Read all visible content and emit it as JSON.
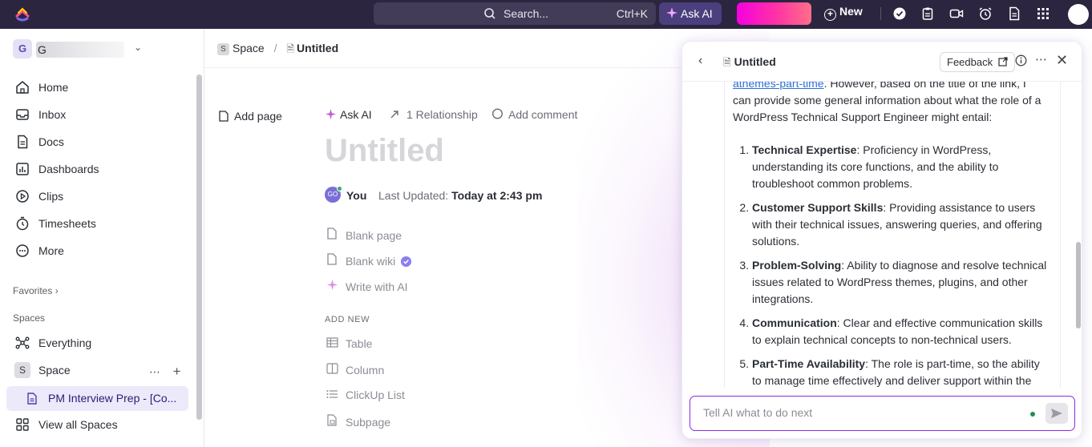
{
  "topbar": {
    "search_placeholder": "Search...",
    "search_shortcut": "Ctrl+K",
    "ask_ai_label": "Ask AI",
    "new_label": "New",
    "icons": [
      "check-circle-icon",
      "clipboard-icon",
      "video-icon",
      "alarm-clock-icon",
      "document-icon",
      "apps-grid-icon"
    ]
  },
  "sidebar": {
    "workspace_initial": "G",
    "workspace_name": "G",
    "nav": [
      {
        "label": "Home",
        "icon": "home-icon"
      },
      {
        "label": "Inbox",
        "icon": "inbox-icon"
      },
      {
        "label": "Docs",
        "icon": "docs-icon"
      },
      {
        "label": "Dashboards",
        "icon": "dashboards-icon"
      },
      {
        "label": "Clips",
        "icon": "clips-icon"
      },
      {
        "label": "Timesheets",
        "icon": "timesheets-icon"
      },
      {
        "label": "More",
        "icon": "more-icon"
      }
    ],
    "favorites_label": "Favorites",
    "spaces_label": "Spaces",
    "everything_label": "Everything",
    "space_initial": "S",
    "space_label": "Space",
    "active_doc_label": "PM Interview Prep - [Co...",
    "view_all_label": "View all Spaces"
  },
  "main": {
    "breadcrumb_space_initial": "S",
    "breadcrumb_space": "Space",
    "breadcrumb_current": "Untitled",
    "add_page_label": "Add page",
    "ask_ai_label": "Ask AI",
    "relationship_label": "1  Relationship",
    "add_comment_label": "Add comment",
    "title_placeholder": "Untitled",
    "author_initials": "GO",
    "author_name": "You",
    "last_updated_label": "Last Updated:",
    "last_updated_value": "Today at 2:43 pm",
    "options": [
      {
        "label": "Blank page",
        "icon": "page-icon"
      },
      {
        "label": "Blank wiki",
        "icon": "page-icon"
      },
      {
        "label": "Write with AI",
        "icon": "sparkle-icon"
      }
    ],
    "add_new_label": "ADD NEW",
    "add_new_items": [
      {
        "label": "Table",
        "icon": "table-icon"
      },
      {
        "label": "Column",
        "icon": "column-icon"
      },
      {
        "label": "ClickUp List",
        "icon": "list-icon"
      },
      {
        "label": "Subpage",
        "icon": "subpage-icon"
      }
    ]
  },
  "ai_panel": {
    "title": "Untitled",
    "feedback_label": "Feedback",
    "intro_link": "athemes-part-time",
    "intro_text": ". However, based on the title of the link, I can provide some general information about what the role of a WordPress Technical Support Engineer might entail:",
    "points": [
      {
        "title": "Technical Expertise",
        "text": ": Proficiency in WordPress, understanding its core functions, and the ability to troubleshoot common problems."
      },
      {
        "title": "Customer Support Skills",
        "text": ": Providing assistance to users with their technical issues, answering queries, and offering solutions."
      },
      {
        "title": "Problem-Solving",
        "text": ": Ability to diagnose and resolve technical issues related to WordPress themes, plugins, and other integrations."
      },
      {
        "title": "Communication",
        "text": ": Clear and effective communication skills to explain technical concepts to non-technical users."
      },
      {
        "title": "Part-Time Availability",
        "text": ": The role is part-time, so the ability to manage time effectively and deliver support within the"
      }
    ],
    "input_placeholder": "Tell AI what to do next"
  }
}
